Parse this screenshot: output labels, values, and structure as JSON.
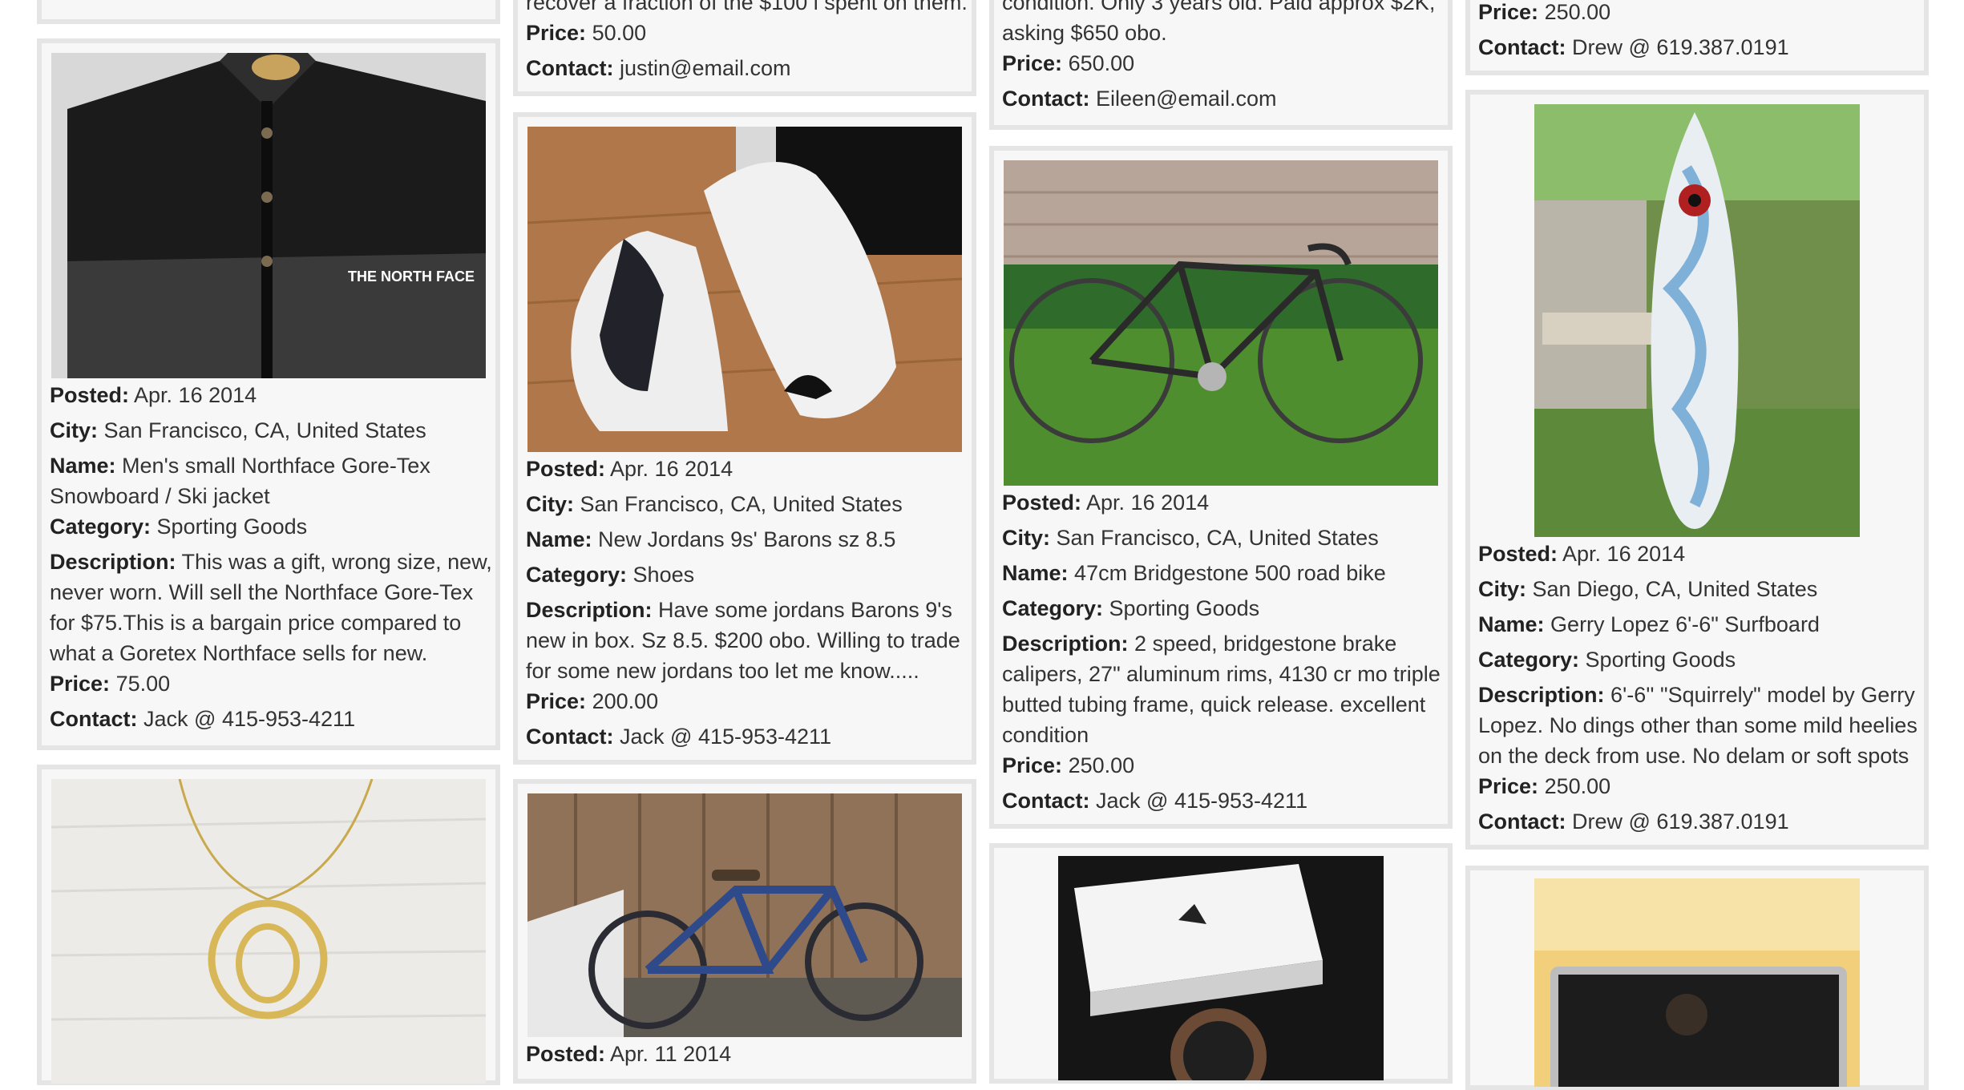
{
  "labels": {
    "posted": "Posted:",
    "city": "City:",
    "name": "Name:",
    "category": "Category:",
    "description": "Description:",
    "price": "Price:",
    "contact": "Contact:"
  },
  "col1": {
    "jacket": {
      "image_icon": "north-face-jacket-photo",
      "image_text": "THE NORTH FACE",
      "posted": "Apr. 16 2014",
      "city": "San Francisco, CA, United States",
      "name_line1": "Men's small Northface Gore-Tex",
      "name_line2": "Snowboard / Ski jacket",
      "category": "Sporting Goods",
      "desc_line1": "This was a gift, wrong size, new,",
      "desc_line2": "never worn. Will sell the Northface Gore-Tex",
      "desc_line3": "for $75.This is a bargain price compared to",
      "desc_line4": "what a Goretex Northface sells for new.",
      "price": "75.00",
      "contact": "Jack @ 415-953-4211"
    },
    "necklace": {
      "image_icon": "gold-necklace-photo"
    }
  },
  "col2": {
    "top": {
      "desc_tail": "recover a fraction of the $100 i spent on them.",
      "price": "50.00",
      "contact": "justin@email.com"
    },
    "jordans": {
      "image_icon": "jordan-sneakers-photo",
      "posted": "Apr. 16 2014",
      "city": "San Francisco, CA, United States",
      "name": "New Jordans 9s' Barons sz 8.5",
      "category": "Shoes",
      "desc_line1": "Have some jordans Barons 9's",
      "desc_line2": "new in box. Sz 8.5. $200 obo. Willing to trade",
      "desc_line3": "for some new jordans too let me know.....",
      "price": "200.00",
      "contact": "Jack @ 415-953-4211"
    },
    "bluebike": {
      "image_icon": "blue-bicycle-photo",
      "posted": "Apr. 11 2014"
    }
  },
  "col3": {
    "top": {
      "desc_tail1": "condition. Only 3 years old. Paid approx $2K,",
      "desc_tail2": "asking $650 obo.",
      "price": "650.00",
      "contact": "Eileen@email.com"
    },
    "roadbike": {
      "image_icon": "road-bike-photo",
      "posted": "Apr. 16 2014",
      "city": "San Francisco, CA, United States",
      "name": "47cm Bridgestone 500 road bike",
      "category": "Sporting Goods",
      "desc_line1": "2 speed, bridgestone brake",
      "desc_line2": "calipers, 27\" aluminum rims, 4130 cr mo triple",
      "desc_line3": "butted tubing frame, quick release. excellent",
      "desc_line4": "condition",
      "price": "250.00",
      "contact": "Jack @ 415-953-4211"
    },
    "watch": {
      "image_icon": "nixon-watch-box-photo"
    }
  },
  "col4": {
    "top": {
      "price": "250.00",
      "contact": "Drew @ 619.387.0191"
    },
    "surfboard": {
      "image_icon": "surfboard-photo",
      "posted": "Apr. 16 2014",
      "city": "San Diego, CA, United States",
      "name": "Gerry Lopez 6'-6\" Surfboard",
      "category": "Sporting Goods",
      "desc_line1": "6'-6'' \"Squirrely\" model by Gerry",
      "desc_line2": "Lopez. No dings other than some mild heelies",
      "desc_line3": "on the deck from use. No delam or soft spots",
      "price": "250.00",
      "contact": "Drew @ 619.387.0191"
    },
    "laptop": {
      "image_icon": "laptop-photo"
    }
  },
  "colors": {
    "card_bg": "#f7f7f7",
    "card_border": "#e5e5e5",
    "text": "#333333",
    "label": "#222222"
  }
}
